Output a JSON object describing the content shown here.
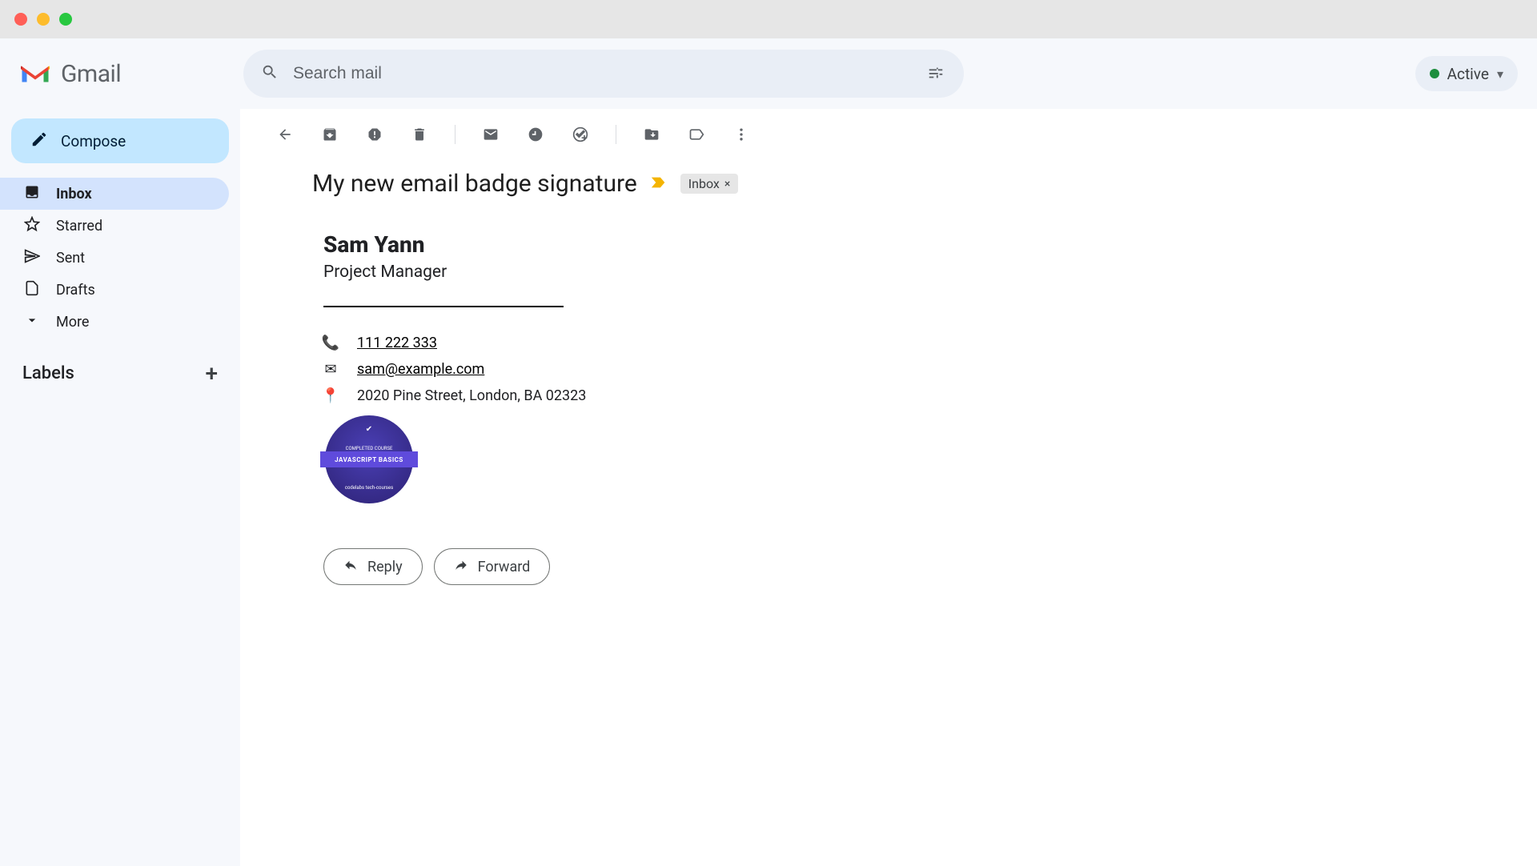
{
  "app": {
    "name": "Gmail"
  },
  "search": {
    "placeholder": "Search mail"
  },
  "status": {
    "label": "Active"
  },
  "compose": {
    "label": "Compose"
  },
  "sidebar": {
    "items": [
      "Inbox",
      "Starred",
      "Sent",
      "Drafts",
      "More"
    ],
    "active_index": 0,
    "labels_header": "Labels"
  },
  "message": {
    "subject": "My new email badge signature",
    "chip_label": "Inbox",
    "signature": {
      "name": "Sam Yann",
      "title": "Project Manager",
      "phone": "111 222 333",
      "email": "sam@example.com",
      "address": "2020 Pine Street, London, BA 02323",
      "badge": {
        "topline": "COMPLETED COURSE",
        "main": "JAVASCRIPT BASICS",
        "footer": "codelabs tech-courses"
      }
    },
    "actions": {
      "reply": "Reply",
      "forward": "Forward"
    }
  }
}
